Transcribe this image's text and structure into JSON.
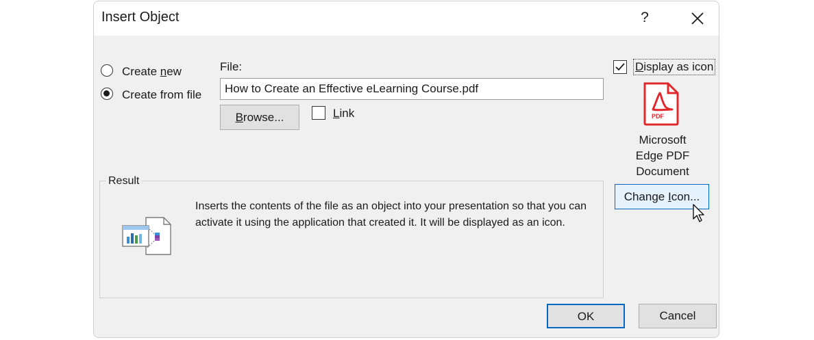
{
  "dialog": {
    "title": "Insert Object",
    "help_glyph": "?",
    "create_new_prefix": "Create ",
    "create_new_key": "n",
    "create_new_suffix": "ew",
    "create_from_file_label": "Create from file",
    "file_label": "File:",
    "file_value": "How to Create an Effective eLearning Course.pdf",
    "browse_key": "B",
    "browse_rest": "rowse...",
    "link_key": "L",
    "link_rest": "ink",
    "display_as_icon_key": "D",
    "display_as_icon_rest": "isplay as icon",
    "display_as_icon_checked": true,
    "icon_badge": "PDF",
    "icon_caption_lines": [
      "Microsoft",
      "Edge PDF",
      "Document"
    ],
    "change_icon_prefix": "Change ",
    "change_icon_key": "I",
    "change_icon_suffix": "con...",
    "result_label": "Result",
    "result_text": "Inserts the contents of the file as an object into your presentation so that you can activate it using the application that created it. It will be displayed as an icon.",
    "ok_label": "OK",
    "cancel_label": "Cancel"
  },
  "colors": {
    "accent": "#0067c0",
    "pdf_red": "#e0282d"
  },
  "icons": [
    "close-icon",
    "pdf-file-icon",
    "object-result-icon",
    "mouse-cursor-icon",
    "checkmark-icon"
  ]
}
